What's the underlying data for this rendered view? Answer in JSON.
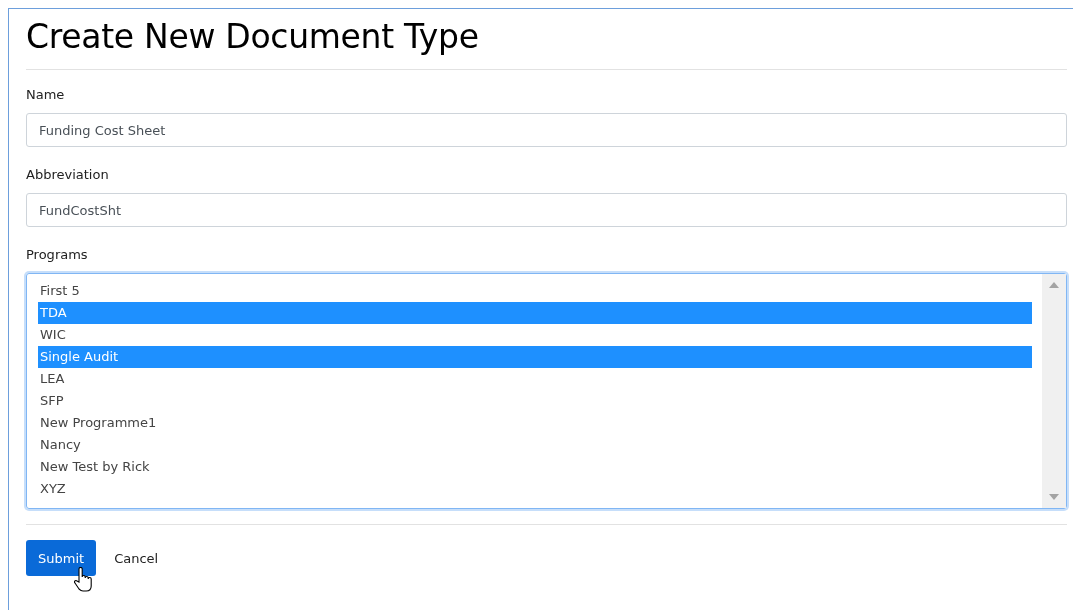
{
  "title": "Create New Document Type",
  "fields": [
    {
      "label": "Name",
      "value": "Funding Cost Sheet"
    },
    {
      "label": "Abbreviation",
      "value": "FundCostSht"
    }
  ],
  "programs": {
    "label": "Programs",
    "options": [
      {
        "label": "First 5",
        "selected": false
      },
      {
        "label": "TDA",
        "selected": true
      },
      {
        "label": "WIC",
        "selected": false
      },
      {
        "label": "Single Audit",
        "selected": true
      },
      {
        "label": "LEA",
        "selected": false
      },
      {
        "label": "SFP",
        "selected": false
      },
      {
        "label": "New Programme1",
        "selected": false
      },
      {
        "label": "Nancy",
        "selected": false
      },
      {
        "label": "New Test by Rick",
        "selected": false
      },
      {
        "label": "XYZ",
        "selected": false
      }
    ]
  },
  "actions": [
    {
      "kind": "primary",
      "label": "Submit"
    },
    {
      "kind": "link",
      "label": "Cancel"
    }
  ]
}
